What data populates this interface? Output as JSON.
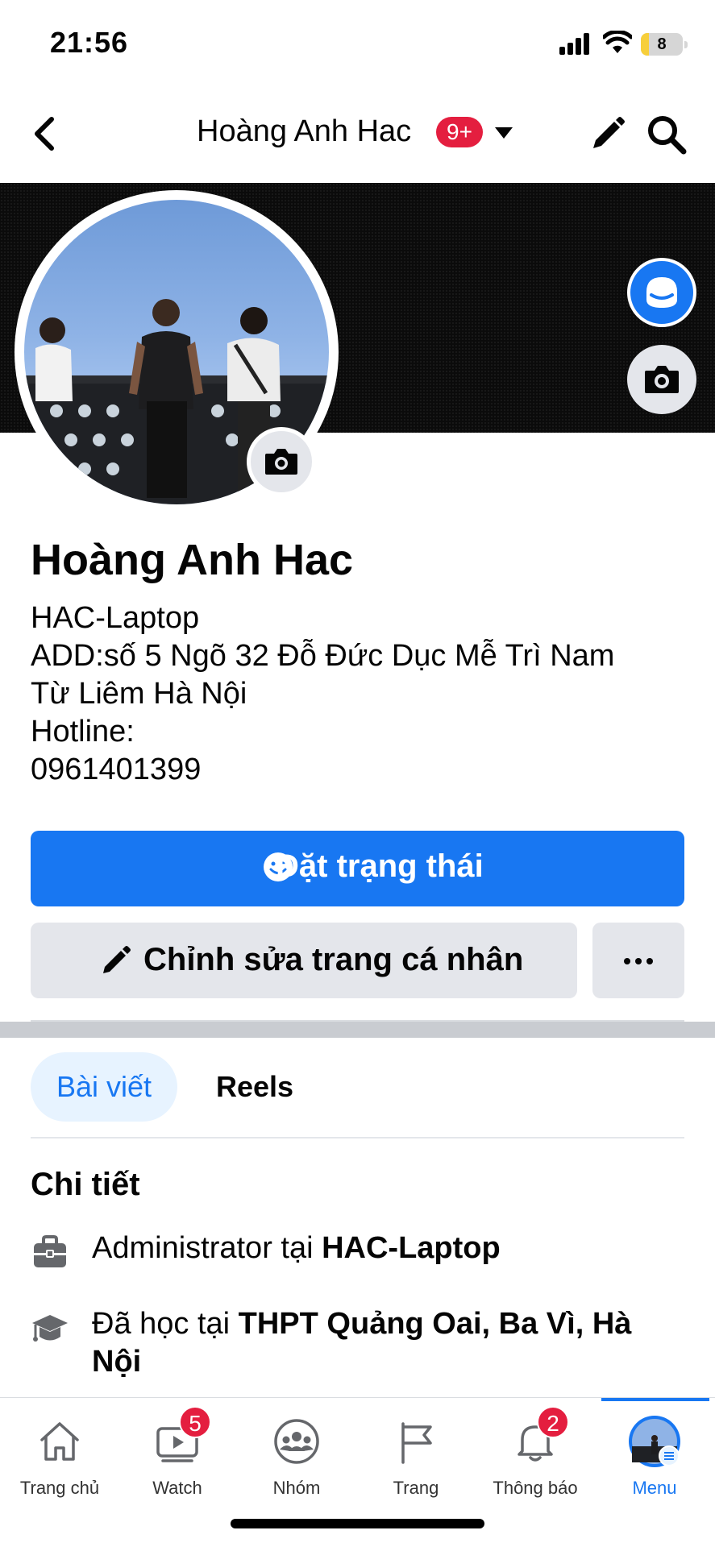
{
  "status_bar": {
    "time": "21:56",
    "battery": "8"
  },
  "header": {
    "title": "Hoàng Anh Hac",
    "badge": "9+"
  },
  "profile": {
    "name": "Hoàng Anh Hac",
    "bio_lines": [
      "HAC-Laptop",
      "ADD:số 5 Ngõ 32 Đỗ Đức Dục Mễ Trì Nam",
      "Từ Liêm Hà Nội",
      "Hotline:",
      "0961401399"
    ]
  },
  "actions": {
    "primary_label": "Đặt trạng thái",
    "edit_label": "Chỉnh sửa trang cá nhân"
  },
  "tabs": [
    {
      "label": "Bài viết",
      "active": true
    },
    {
      "label": "Reels",
      "active": false
    }
  ],
  "details": {
    "title": "Chi tiết",
    "work": {
      "prefix": "Administrator tại ",
      "place": "HAC-Laptop"
    },
    "education": {
      "prefix": "Đã học tại ",
      "place": "THPT  Quảng Oai, Ba Vì, Hà Nội"
    }
  },
  "tabbar": {
    "items": [
      {
        "label": "Trang chủ",
        "icon": "home-icon"
      },
      {
        "label": "Watch",
        "icon": "watch-icon",
        "badge": "5"
      },
      {
        "label": "Nhóm",
        "icon": "groups-icon"
      },
      {
        "label": "Trang",
        "icon": "pages-flag-icon"
      },
      {
        "label": "Thông báo",
        "icon": "bell-icon",
        "badge": "2"
      },
      {
        "label": "Menu",
        "icon": "avatar-menu-icon",
        "active": true
      }
    ]
  },
  "colors": {
    "accent": "#1877f2",
    "badge": "#e41e3f",
    "button_gray": "#e4e6eb"
  }
}
